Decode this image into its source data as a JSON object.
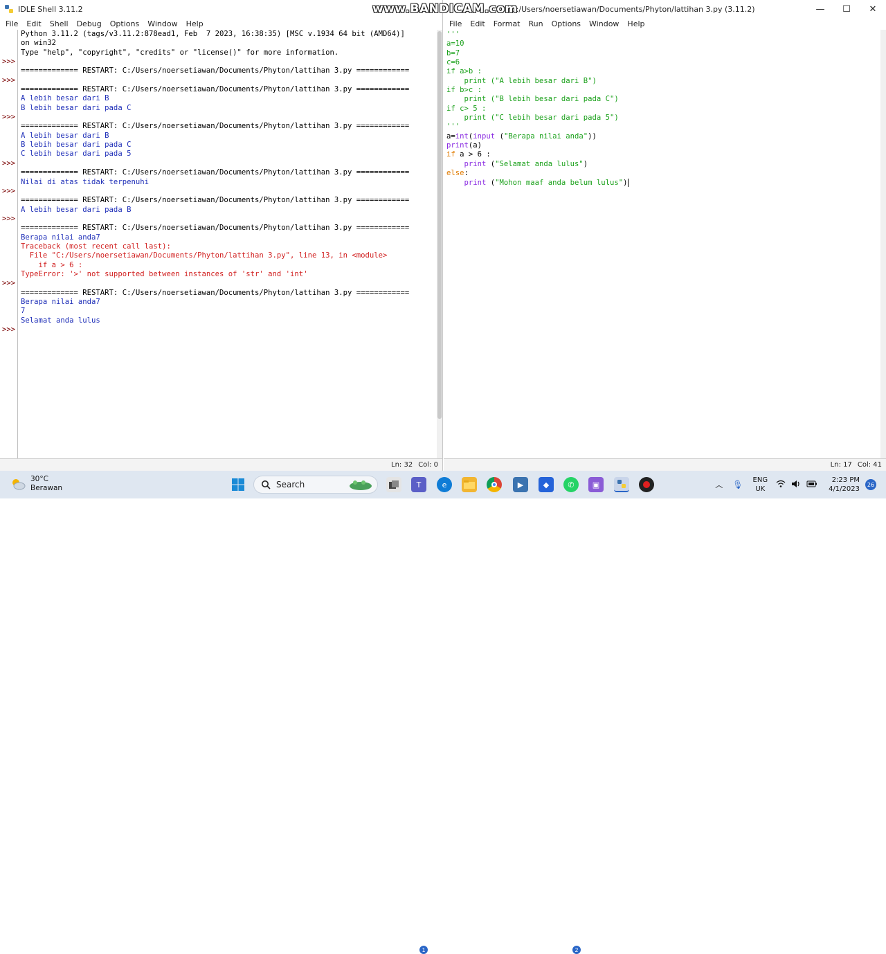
{
  "shell": {
    "title": "IDLE Shell 3.11.2",
    "menu": [
      "File",
      "Edit",
      "Shell",
      "Debug",
      "Options",
      "Window",
      "Help"
    ],
    "status": {
      "line": "Ln: 32",
      "col": "Col: 0"
    },
    "lines": [
      {
        "cls": "c-black",
        "text": "Python 3.11.2 (tags/v3.11.2:878ead1, Feb  7 2023, 16:38:35) [MSC v.1934 64 bit (AMD64)]"
      },
      {
        "cls": "c-black",
        "text": "on win32"
      },
      {
        "cls": "c-black",
        "text": "Type \"help\", \"copyright\", \"credits\" or \"license()\" for more information."
      },
      {
        "cls": "c-black",
        "text": ""
      },
      {
        "cls": "c-black",
        "text": "============= RESTART: C:/Users/noersetiawan/Documents/Phyton/lattihan 3.py ============"
      },
      {
        "cls": "c-black",
        "text": ""
      },
      {
        "cls": "c-black",
        "text": "============= RESTART: C:/Users/noersetiawan/Documents/Phyton/lattihan 3.py ============"
      },
      {
        "cls": "c-out",
        "text": "A lebih besar dari B"
      },
      {
        "cls": "c-out",
        "text": "B lebih besar dari pada C"
      },
      {
        "cls": "c-black",
        "text": ""
      },
      {
        "cls": "c-black",
        "text": "============= RESTART: C:/Users/noersetiawan/Documents/Phyton/lattihan 3.py ============"
      },
      {
        "cls": "c-out",
        "text": "A lebih besar dari B"
      },
      {
        "cls": "c-out",
        "text": "B lebih besar dari pada C"
      },
      {
        "cls": "c-out",
        "text": "C lebih besar dari pada 5"
      },
      {
        "cls": "c-black",
        "text": ""
      },
      {
        "cls": "c-black",
        "text": "============= RESTART: C:/Users/noersetiawan/Documents/Phyton/lattihan 3.py ============"
      },
      {
        "cls": "c-out",
        "text": "Nilai di atas tidak terpenuhi"
      },
      {
        "cls": "c-black",
        "text": ""
      },
      {
        "cls": "c-black",
        "text": "============= RESTART: C:/Users/noersetiawan/Documents/Phyton/lattihan 3.py ============"
      },
      {
        "cls": "c-out",
        "text": "A lebih besar dari pada B"
      },
      {
        "cls": "c-black",
        "text": ""
      },
      {
        "cls": "c-black",
        "text": "============= RESTART: C:/Users/noersetiawan/Documents/Phyton/lattihan 3.py ============"
      },
      {
        "cls": "c-out",
        "text": "Berapa nilai anda7"
      },
      {
        "cls": "c-err",
        "text": "Traceback (most recent call last):"
      },
      {
        "cls": "c-err",
        "text": "  File \"C:/Users/noersetiawan/Documents/Phyton/lattihan 3.py\", line 13, in <module>"
      },
      {
        "cls": "c-err",
        "text": "    if a > 6 :"
      },
      {
        "cls": "c-err",
        "text": "TypeError: '>' not supported between instances of 'str' and 'int'"
      },
      {
        "cls": "c-black",
        "text": ""
      },
      {
        "cls": "c-black",
        "text": "============= RESTART: C:/Users/noersetiawan/Documents/Phyton/lattihan 3.py ============"
      },
      {
        "cls": "c-out",
        "text": "Berapa nilai anda7"
      },
      {
        "cls": "c-out",
        "text": "7"
      },
      {
        "cls": "c-out",
        "text": "Selamat anda lulus"
      }
    ],
    "prompt": ">>>",
    "prompt_rows": [
      3,
      5,
      9,
      14,
      17,
      20,
      27,
      32
    ]
  },
  "editor": {
    "title": "C:/Users/noersetiawan/Documents/Phyton/lattihan 3.py (3.11.2)",
    "menu": [
      "File",
      "Edit",
      "Format",
      "Run",
      "Options",
      "Window",
      "Help"
    ],
    "status": {
      "line": "Ln: 17",
      "col": "Col: 41"
    },
    "lines": [
      [
        {
          "c": "c-grn",
          "t": "'''"
        }
      ],
      [
        {
          "c": "c-grn",
          "t": "a=10"
        }
      ],
      [
        {
          "c": "c-grn",
          "t": "b=7"
        }
      ],
      [
        {
          "c": "c-grn",
          "t": "c=6"
        }
      ],
      [
        {
          "c": "c-grn",
          "t": "if a>b :"
        }
      ],
      [
        {
          "c": "c-grn",
          "t": "    print (\"A lebih besar dari B\")"
        }
      ],
      [
        {
          "c": "c-grn",
          "t": "if b>c :"
        }
      ],
      [
        {
          "c": "c-grn",
          "t": "    print (\"B lebih besar dari pada C\")"
        }
      ],
      [
        {
          "c": "c-grn",
          "t": "if c> 5 :"
        }
      ],
      [
        {
          "c": "c-grn",
          "t": "    print (\"C lebih besar dari pada 5\")"
        }
      ],
      [
        {
          "c": "c-grn",
          "t": "'''"
        }
      ],
      [
        {
          "c": "c-black",
          "t": "a="
        },
        {
          "c": "c-blt",
          "t": "int"
        },
        {
          "c": "c-black",
          "t": "("
        },
        {
          "c": "c-blt",
          "t": "input"
        },
        {
          "c": "c-black",
          "t": " ("
        },
        {
          "c": "c-grn",
          "t": "\"Berapa nilai anda\""
        },
        {
          "c": "c-black",
          "t": "))"
        }
      ],
      [
        {
          "c": "c-blt",
          "t": "print"
        },
        {
          "c": "c-black",
          "t": "(a)"
        }
      ],
      [
        {
          "c": "c-kw",
          "t": "if"
        },
        {
          "c": "c-black",
          "t": " a > 6 :"
        }
      ],
      [
        {
          "c": "c-black",
          "t": "    "
        },
        {
          "c": "c-blt",
          "t": "print"
        },
        {
          "c": "c-black",
          "t": " ("
        },
        {
          "c": "c-grn",
          "t": "\"Selamat anda lulus\""
        },
        {
          "c": "c-black",
          "t": ")"
        }
      ],
      [
        {
          "c": "c-kw",
          "t": "else"
        },
        {
          "c": "c-black",
          "t": ":"
        }
      ],
      [
        {
          "c": "c-black",
          "t": "    "
        },
        {
          "c": "c-blt",
          "t": "print"
        },
        {
          "c": "c-black",
          "t": " ("
        },
        {
          "c": "c-grn",
          "t": "\"Mohon maaf anda belum lulus\""
        },
        {
          "c": "c-black",
          "t": ")"
        }
      ]
    ]
  },
  "watermark": "www.BANDICAM.com",
  "window_controls": {
    "minimize": "—",
    "maximize": "☐",
    "close": "✕"
  },
  "taskbar": {
    "weather": {
      "temp": "30°C",
      "desc": "Berawan"
    },
    "search_label": "Search",
    "language": {
      "lang": "ENG",
      "region": "UK"
    },
    "clock": {
      "time": "2:23 PM",
      "date": "4/1/2023"
    },
    "notification_count": "26",
    "teams_badge": "1",
    "whatsapp_badge": "2"
  }
}
